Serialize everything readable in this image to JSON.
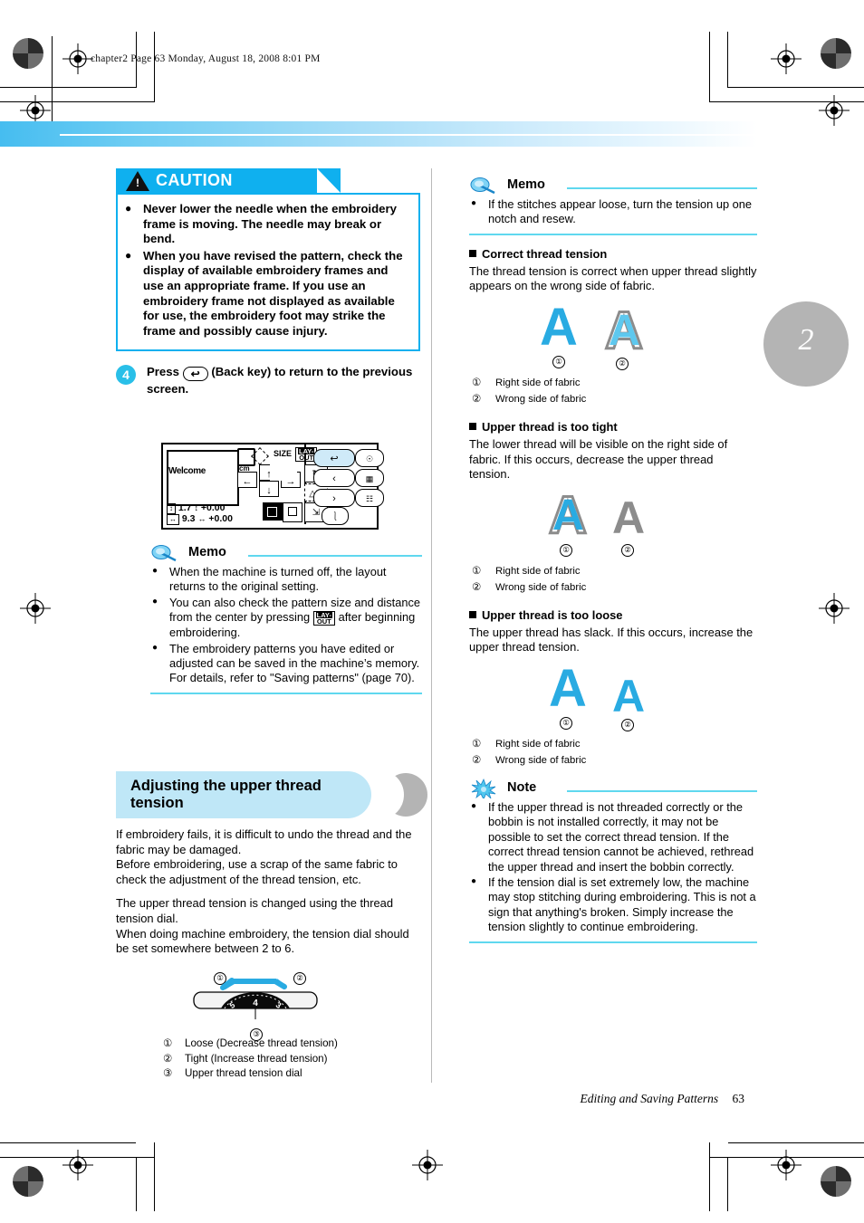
{
  "running_head": "chapter2  Page 63  Monday, August 18, 2008  8:01 PM",
  "chapter_tab": "2",
  "footer": {
    "title": "Editing and Saving Patterns",
    "page": "63"
  },
  "caution": {
    "title": "CAUTION",
    "items": [
      "Never lower the needle when the embroidery frame is moving. The needle may break or bend.",
      "When you have revised the pattern, check the display of available embroidery frames and use an appropriate frame. If you use an embroidery frame not displayed as available for use, the embroidery foot may strike the frame and possibly cause injury."
    ]
  },
  "step4": {
    "number": "4",
    "text_before": "Press",
    "key_glyph": "↩",
    "text_after": "(Back key) to return to the previous screen."
  },
  "lcd": {
    "welcome": "Welcome",
    "unit": "cm",
    "size_label": "SIZE",
    "layout_label_top": "LAY-",
    "layout_label_bottom": "OUT",
    "height_value": "1.7",
    "height_offset": "+0.00",
    "width_value": "9.3",
    "width_offset": "+0.00",
    "back_key": "↩",
    "prev_key": "‹",
    "next_key": "›",
    "up_key": "↑",
    "down_key": "↓",
    "left_key": "←",
    "right_key": "→",
    "rotate_key": "↻",
    "mirror_key": "△▷"
  },
  "memo_left": {
    "title": "Memo",
    "items_1": "When the machine is turned off, the layout returns to the original setting.",
    "items_2a": "You can also check the pattern size and distance from the center by pressing",
    "items_2b": "after beginning embroidering.",
    "items_3": "The embroidery patterns you have edited or adjusted can be saved in the machine’s memory. For details, refer to \"Saving patterns\" (page 70)."
  },
  "section": {
    "title": "Adjusting the upper thread tension",
    "para1": "If embroidery fails, it is difficult to undo the thread and the fabric may be damaged.\nBefore embroidering, use a scrap of the same fabric to check the adjustment of the thread tension, etc.",
    "para2": "The upper thread tension is changed using the thread tension dial.\nWhen doing machine embroidery, the tension dial should be set somewhere between 2 to 6."
  },
  "dial": {
    "marks": [
      "5",
      "4",
      "3"
    ],
    "callout_1": "①",
    "callout_2": "②",
    "callout_3": "③",
    "legend": [
      {
        "n": "①",
        "t": "Loose (Decrease thread tension)"
      },
      {
        "n": "②",
        "t": "Tight (Increase thread tension)"
      },
      {
        "n": "③",
        "t": "Upper thread tension dial"
      }
    ]
  },
  "memo_right": {
    "title": "Memo",
    "item": "If the stitches appear loose, turn the tension up one notch and resew."
  },
  "tension_sections": [
    {
      "heading": "Correct thread tension",
      "body": "The thread tension is correct when upper thread slightly appears on the wrong side of fabric.",
      "fig": {
        "a1_style": "solid-cyan",
        "a2_style": "gray-outline-cyan"
      },
      "legend": [
        {
          "n": "①",
          "t": "Right side of fabric"
        },
        {
          "n": "②",
          "t": "Wrong side of fabric"
        }
      ]
    },
    {
      "heading": "Upper thread is too tight",
      "body": "The lower thread will be visible on the right side of fabric. If this occurs, decrease the upper thread tension.",
      "fig": {
        "a1_style": "cyan-gray-outline",
        "a2_style": "solid-gray"
      },
      "legend": [
        {
          "n": "①",
          "t": "Right side of fabric"
        },
        {
          "n": "②",
          "t": "Wrong side of fabric"
        }
      ]
    },
    {
      "heading": "Upper thread is too loose",
      "body": "The upper thread has slack. If this occurs, increase the upper thread tension.",
      "fig": {
        "a1_style": "solid-cyan",
        "a2_style": "cyan-hatch"
      },
      "legend": [
        {
          "n": "①",
          "t": "Right side of fabric"
        },
        {
          "n": "②",
          "t": "Wrong side of fabric"
        }
      ]
    }
  ],
  "note": {
    "title": "Note",
    "items": [
      "If the upper thread is not threaded correctly or the bobbin is not installed correctly, it may not be possible to set the correct thread tension. If the correct thread tension cannot be achieved, rethread the upper thread and insert the bobbin correctly.",
      "If the tension dial is set extremely low, the machine may stop stitching during embroidering. This is not a sign that anything's broken. Simply increase the tension slightly to continue embroidering."
    ]
  },
  "colors": {
    "caution_blue": "#0fb0ef",
    "accent_cyan": "#29bfe8",
    "rule_cyan": "#5fd8ef",
    "section_band": "#bfe7f7",
    "gray_tab": "#b4b4b4",
    "fabric_cyan": "#29abe2",
    "fabric_gray": "#8c8c8c"
  }
}
